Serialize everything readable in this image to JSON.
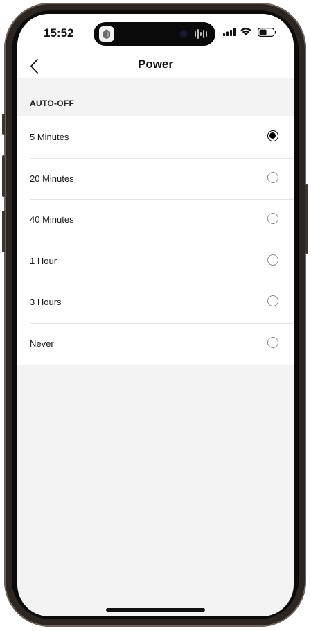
{
  "status_bar": {
    "time": "15:52"
  },
  "nav": {
    "title": "Power"
  },
  "section": {
    "title": "AUTO-OFF"
  },
  "options": [
    {
      "label": "5 Minutes",
      "selected": true
    },
    {
      "label": "20 Minutes",
      "selected": false
    },
    {
      "label": "40 Minutes",
      "selected": false
    },
    {
      "label": "1 Hour",
      "selected": false
    },
    {
      "label": "3 Hours",
      "selected": false
    },
    {
      "label": "Never",
      "selected": false
    }
  ],
  "icons": {
    "back": "chevron-left-icon",
    "signal": "cellular-signal-icon",
    "wifi": "wifi-icon",
    "battery": "battery-icon",
    "app": "app-activity-icon",
    "audio": "audio-waveform-icon"
  },
  "colors": {
    "background": "#f3f3f3",
    "surface": "#ffffff",
    "text": "#111111",
    "radio_selected": "#000000",
    "radio_unselected": "#8a8a8a"
  }
}
